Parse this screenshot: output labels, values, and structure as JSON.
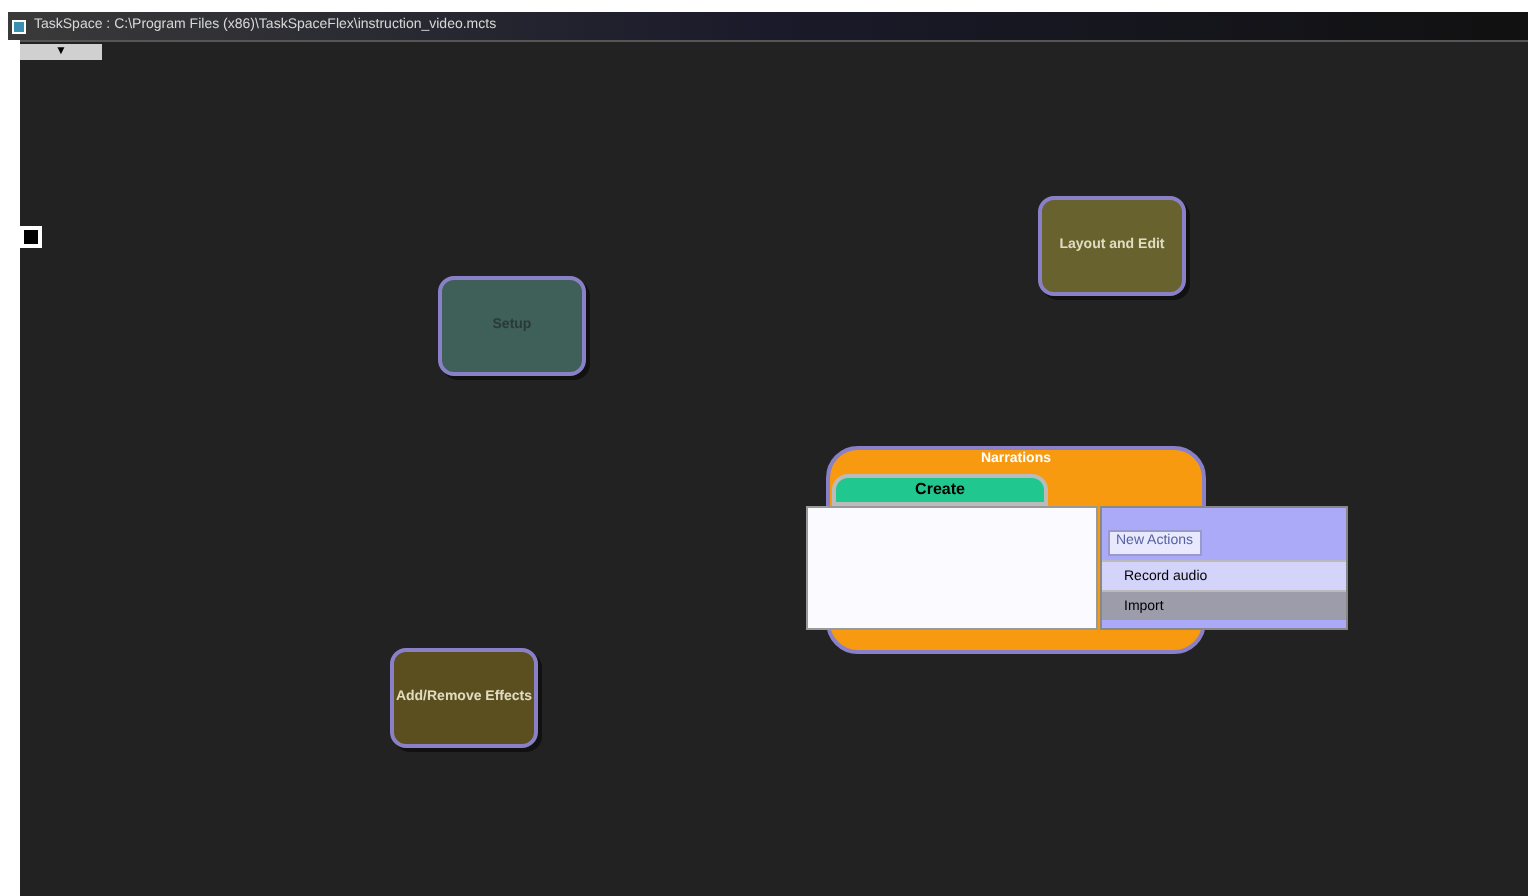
{
  "window": {
    "title": "TaskSpace  : C:\\Program Files (x86)\\TaskSpaceFlex\\instruction_video.mcts"
  },
  "dropdown": {
    "label": "▼"
  },
  "nodes": [
    {
      "label": "Setup",
      "color": "#3f6058",
      "dim": true
    },
    {
      "label": "Layout and Edit",
      "color": "#67622e",
      "dim": false
    },
    {
      "label": "Add/Remove Effects",
      "color": "#5b4e1f",
      "dim": false
    }
  ],
  "group": {
    "title": "Narrations",
    "tab": "Create"
  },
  "menu": {
    "header": "New Actions",
    "items": [
      {
        "label": "Record audio",
        "selected": false
      },
      {
        "label": "Import",
        "selected": true
      }
    ]
  }
}
